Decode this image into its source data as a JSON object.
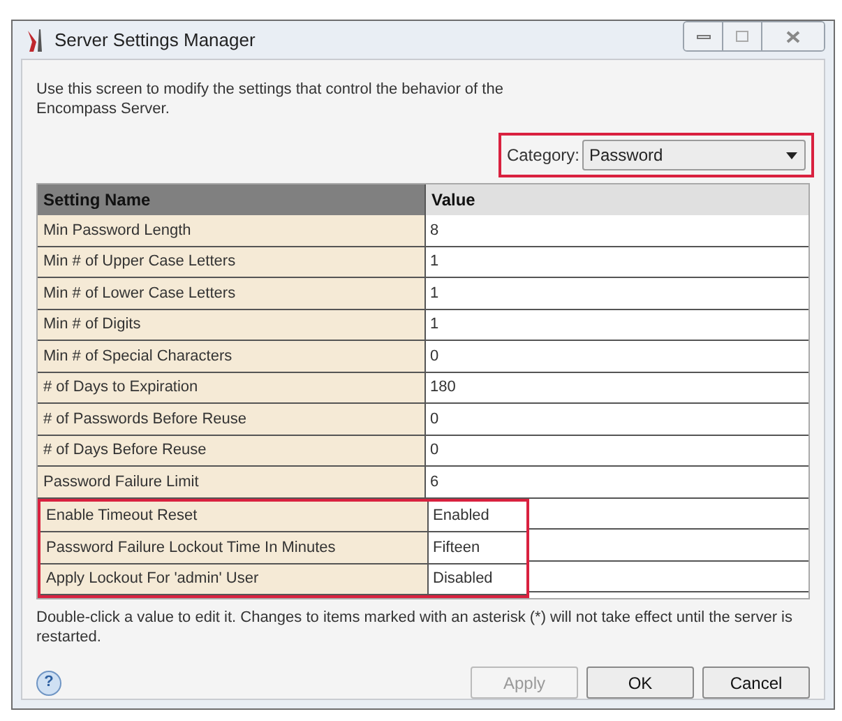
{
  "window": {
    "title": "Server Settings Manager"
  },
  "intro": "Use this screen to modify the settings that control the behavior of the Encompass Server.",
  "category": {
    "label": "Category:",
    "value": "Password",
    "highlighted": true
  },
  "table": {
    "columns": [
      "Setting Name",
      "Value"
    ],
    "rows": [
      {
        "name": "Min Password Length",
        "value": "8",
        "highlighted": false
      },
      {
        "name": "Min # of Upper Case Letters",
        "value": "1",
        "highlighted": false
      },
      {
        "name": "Min # of Lower Case Letters",
        "value": "1",
        "highlighted": false
      },
      {
        "name": "Min # of Digits",
        "value": "1",
        "highlighted": false
      },
      {
        "name": "Min # of Special Characters",
        "value": "0",
        "highlighted": false
      },
      {
        "name": "# of Days to Expiration",
        "value": "180",
        "highlighted": false
      },
      {
        "name": "# of Passwords Before Reuse",
        "value": "0",
        "highlighted": false
      },
      {
        "name": "# of Days Before Reuse",
        "value": "0",
        "highlighted": false
      },
      {
        "name": "Password Failure Limit",
        "value": "6",
        "highlighted": false
      },
      {
        "name": "Enable Timeout Reset",
        "value": "Enabled",
        "highlighted": true
      },
      {
        "name": "Password Failure Lockout Time In Minutes",
        "value": "Fifteen",
        "highlighted": true
      },
      {
        "name": "Apply Lockout For 'admin' User",
        "value": "Disabled",
        "highlighted": true
      }
    ]
  },
  "note": "Double-click a value to edit it. Changes to items marked with an asterisk (*) will not take effect until the server is restarted.",
  "help": "?",
  "buttons": [
    {
      "label": "Apply",
      "disabled": true
    },
    {
      "label": "OK",
      "disabled": false
    },
    {
      "label": "Cancel",
      "disabled": false
    }
  ]
}
